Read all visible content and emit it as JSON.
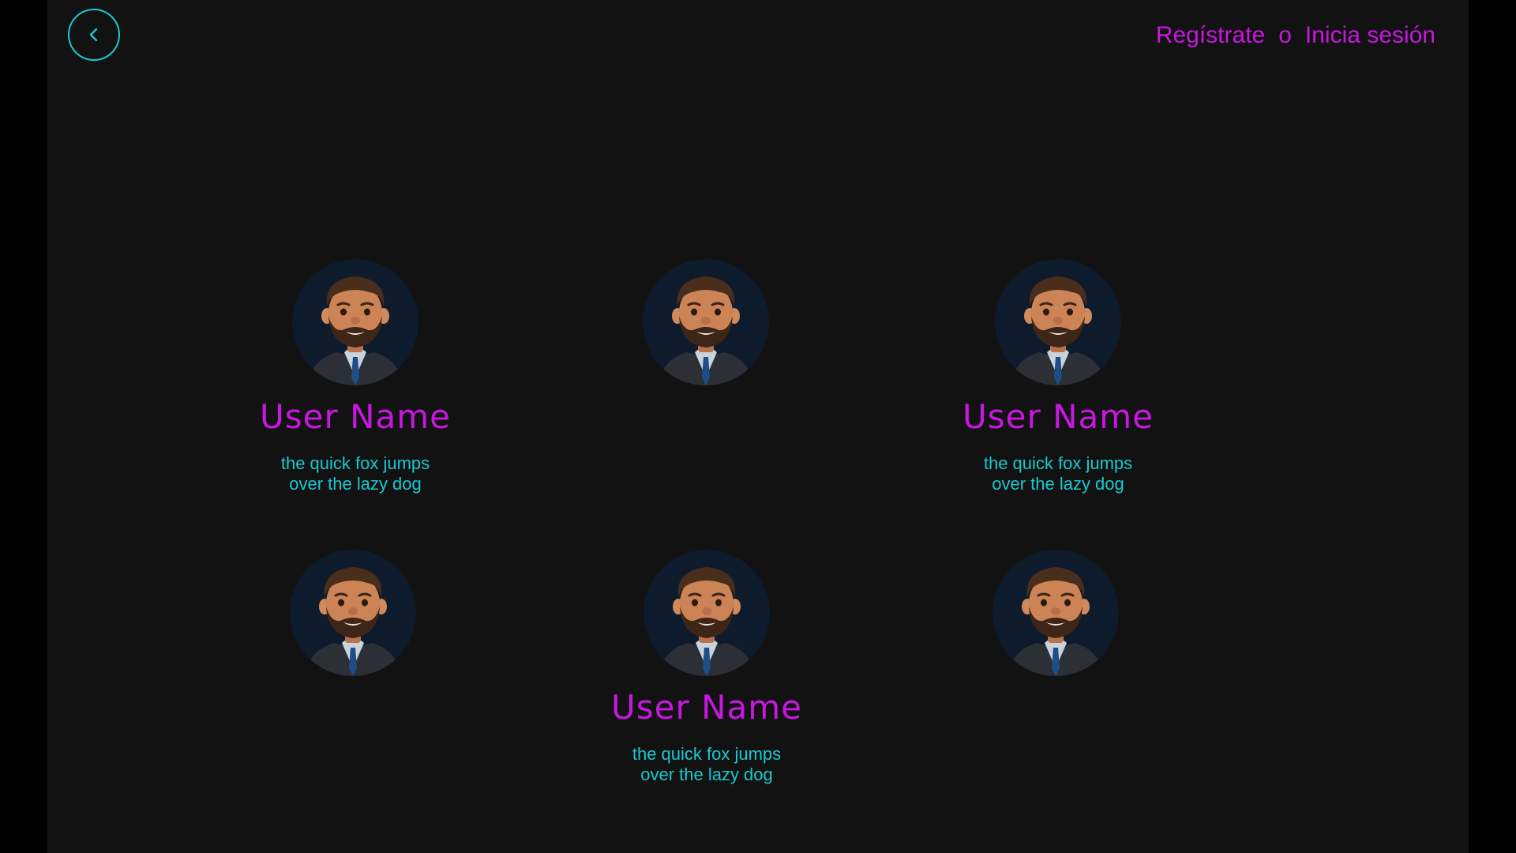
{
  "header": {
    "back_icon": "chevron-left-icon",
    "register_label": "Regístrate",
    "separator": "o",
    "login_label": "Inicia sesión"
  },
  "colors": {
    "accent_magenta": "#c817e0",
    "accent_cyan": "#19c9d0",
    "background": "#121212",
    "avatar_bg": "#0d1b2c"
  },
  "users": [
    {
      "name": "User Name",
      "description": "the quick fox jumps\n over the lazy dog",
      "avatar": "bearded-man-avatar"
    },
    {
      "avatar": "bearded-man-avatar"
    },
    {
      "name": "User Name",
      "description": "the quick fox jumps\n over the lazy dog",
      "avatar": "bearded-man-avatar"
    },
    {
      "avatar": "bearded-man-avatar"
    },
    {
      "name": "User Name",
      "description": "the quick fox jumps\n over the lazy dog",
      "avatar": "bearded-man-avatar"
    },
    {
      "avatar": "bearded-man-avatar"
    }
  ]
}
